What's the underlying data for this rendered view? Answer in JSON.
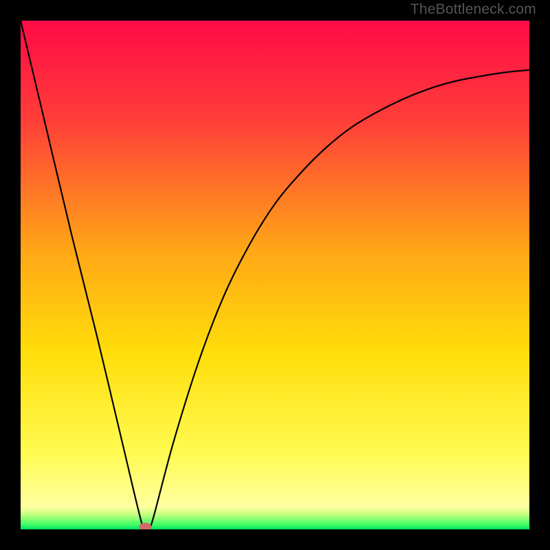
{
  "watermark": "TheBottleneck.com",
  "chart_data": {
    "type": "line",
    "title": "",
    "xlabel": "",
    "ylabel": "",
    "xlim": [
      0,
      100
    ],
    "ylim": [
      0,
      100
    ],
    "x": [
      0,
      5,
      10,
      15,
      20,
      24,
      25,
      26,
      30,
      35,
      40,
      45,
      50,
      55,
      60,
      65,
      70,
      75,
      80,
      85,
      90,
      95,
      100
    ],
    "y": [
      100,
      79,
      58,
      38,
      17,
      0.5,
      0,
      2,
      17,
      33,
      46,
      56,
      64,
      70,
      75,
      79,
      82,
      84.5,
      86.5,
      88,
      89,
      89.8,
      90.3
    ],
    "minimum_marker": {
      "x": 24.5,
      "y": 0.5
    },
    "green_band_y_range": [
      0,
      3
    ],
    "yellow_band_y_range": [
      3,
      12
    ],
    "gradient_stops": [
      {
        "pos": 0.0,
        "color": "#ff0a47"
      },
      {
        "pos": 0.2,
        "color": "#ff3f38"
      },
      {
        "pos": 0.45,
        "color": "#ffa617"
      },
      {
        "pos": 0.65,
        "color": "#ffdd0a"
      },
      {
        "pos": 0.85,
        "color": "#fffb50"
      },
      {
        "pos": 0.955,
        "color": "#ffffa0"
      },
      {
        "pos": 0.97,
        "color": "#c8ff80"
      },
      {
        "pos": 0.99,
        "color": "#44ff66"
      },
      {
        "pos": 1.0,
        "color": "#00e060"
      }
    ]
  },
  "marker_color": "#d06a6a"
}
